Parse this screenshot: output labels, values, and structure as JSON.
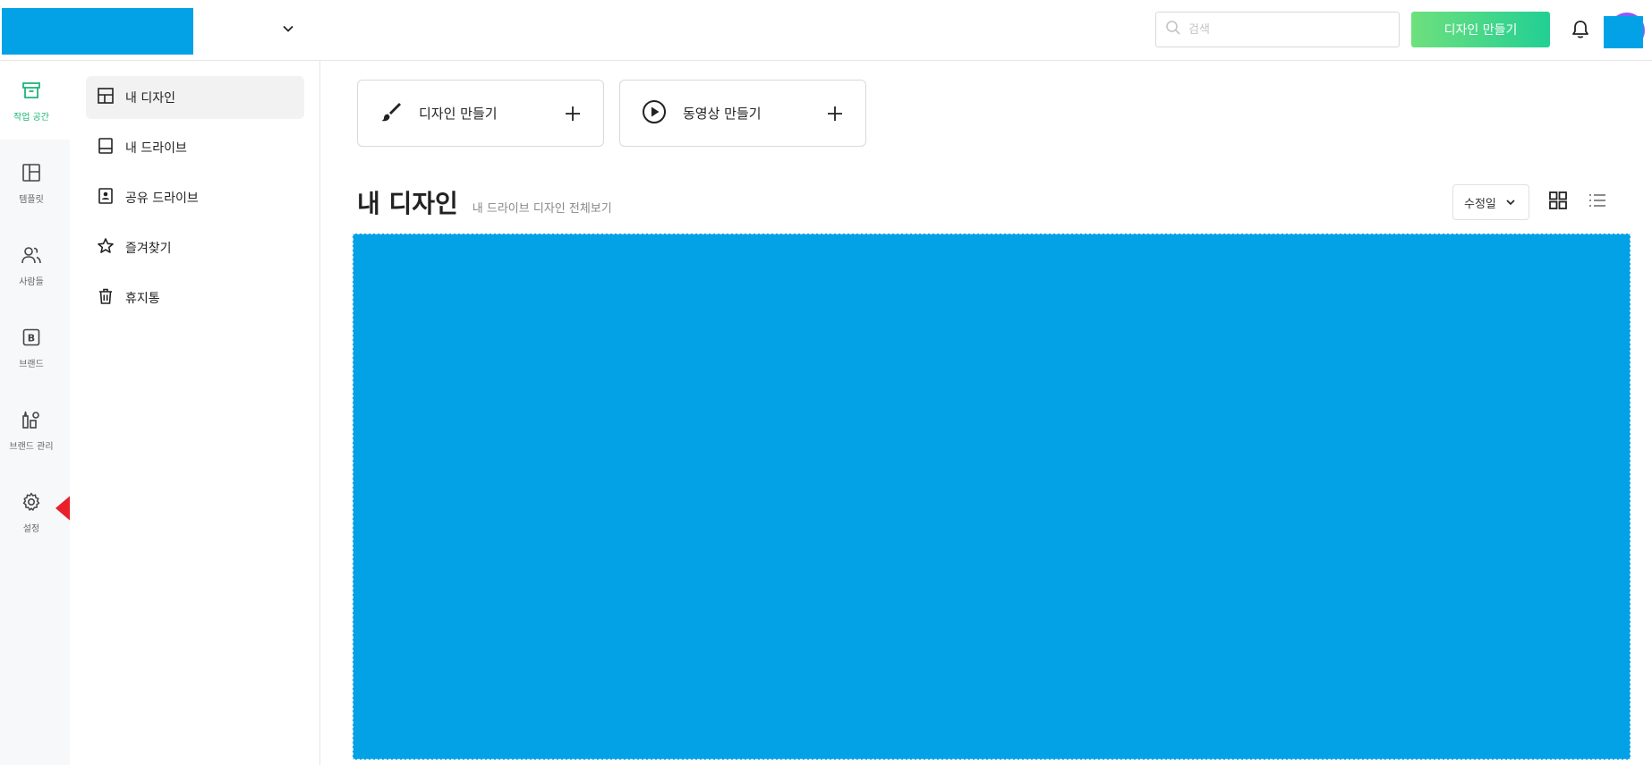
{
  "header": {
    "search_placeholder": "검색",
    "create_button_label": "디자인 만들기"
  },
  "rail": {
    "items": [
      {
        "label": "작업 공간",
        "icon": "archive-box-icon",
        "active": true
      },
      {
        "label": "템플릿",
        "icon": "layout-template-icon"
      },
      {
        "label": "사람들",
        "icon": "people-icon"
      },
      {
        "label": "브랜드",
        "icon": "brand-b-icon"
      },
      {
        "label": "브랜드 관리",
        "icon": "brand-manage-icon"
      },
      {
        "label": "설정",
        "icon": "gear-icon"
      }
    ]
  },
  "subnav": {
    "items": [
      {
        "label": "내 디자인",
        "icon": "grid-layout-icon",
        "active": true
      },
      {
        "label": "내 드라이브",
        "icon": "drive-icon"
      },
      {
        "label": "공유 드라이브",
        "icon": "shared-drive-icon"
      },
      {
        "label": "즐겨찾기",
        "icon": "star-icon"
      },
      {
        "label": "휴지통",
        "icon": "trash-icon"
      }
    ]
  },
  "main": {
    "actions": [
      {
        "label": "디자인 만들기",
        "icon": "brush-icon"
      },
      {
        "label": "동영상 만들기",
        "icon": "play-circle-icon"
      }
    ],
    "title": "내 디자인",
    "title_link": "내 드라이브 디자인 전체보기",
    "sort_label": "수정일"
  },
  "colors": {
    "accent": "#1fb57a",
    "redacted": "#03a2e6",
    "pointer_arrow": "#e8202a"
  }
}
